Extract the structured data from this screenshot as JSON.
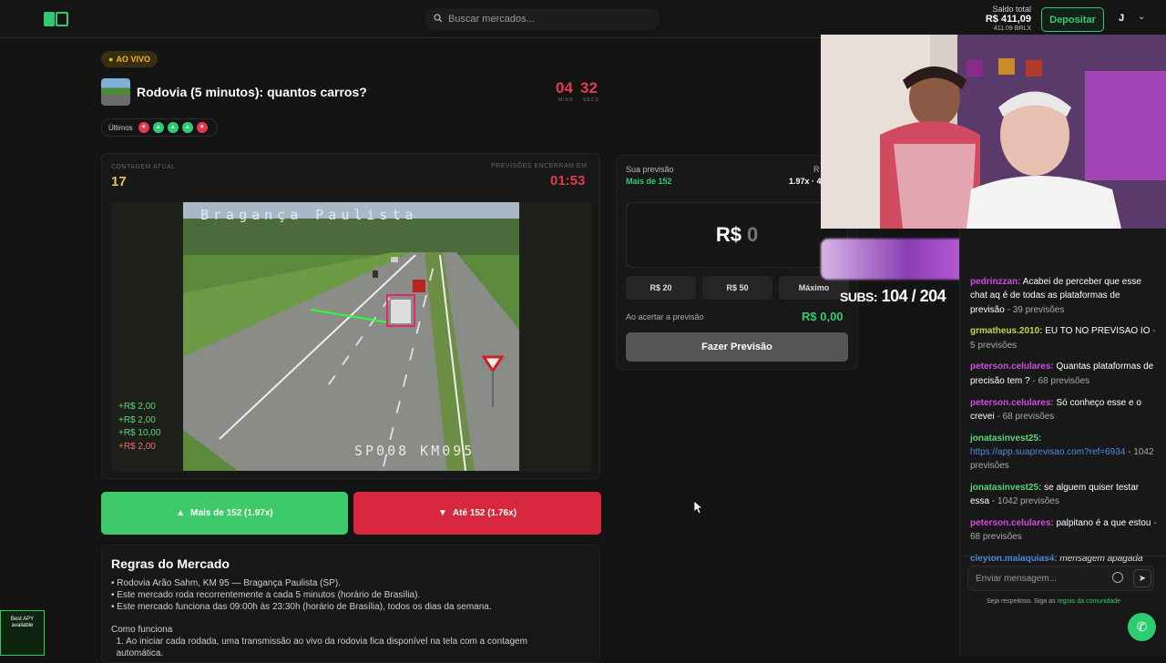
{
  "header": {
    "search_placeholder": "Buscar mercados...",
    "balance_label": "Saldo total",
    "balance_value": "R$ 411,09",
    "balance_sub": "411.09 BRLX",
    "deposit_label": "Depositar",
    "user_initial": "J"
  },
  "market": {
    "live_label": "AO VIVO",
    "title": "Rodovia (5 minutos): quantos carros?",
    "timer_min": "04",
    "timer_sec": "32",
    "timer_min_label": "MINS",
    "timer_sec_label": "SECS",
    "last_label": "Últimos",
    "last_results": [
      "down",
      "up",
      "up",
      "up",
      "down"
    ],
    "count_label": "CONTAGEM ATUAL",
    "count_value": "17",
    "ends_label": "PREVISÕES ENCERRAM EM",
    "ends_value": "01:53",
    "cam_title": "Bragança Paulista",
    "cam_code": "SP008 KM095",
    "recent_bets": [
      "+R$ 2,00",
      "+R$ 2,00",
      "+R$ 10,00",
      "+R$ 2,00"
    ],
    "btn_up_label": "Mais de 152 (1.97x)",
    "btn_down_label": "Até 152 (1.76x)"
  },
  "rules": {
    "title": "Regras do Mercado",
    "text": "• Rodovia Arão Sahm, KM 95 — Bragança Paulista (SP).\n• Este mercado roda recorrentemente a cada 5 minutos (horário de Brasília).\n• Este mercado funciona das 09:00h às 23:30h (horário de Brasília), todos os dias da semana.\n\nComo funciona\n  1. Ao iniciar cada rodada, uma transmissão ao vivo da rodovia fica disponível na tela com a contagem\n  automática."
  },
  "prediction": {
    "label": "Sua previsão",
    "choice": "Mais de 152",
    "right_label": "R",
    "multiplier": "1.97x · 4",
    "currency": "R$",
    "amount": "0",
    "chips": [
      "R$ 20",
      "R$ 50",
      "Máximo"
    ],
    "win_label": "Ao acertar a previsão",
    "win_value": "R$ 0,00",
    "submit_label": "Fazer Previsão"
  },
  "stream": {
    "subs_label": "SUBS:",
    "subs_value": "104 / 204"
  },
  "chat": {
    "messages": [
      {
        "user": "pedrinzzan:",
        "text": "Acabei de perceber que esse chat aq é de todas as plataformas de previsão",
        "count": " - 39 previsões",
        "style": "u1"
      },
      {
        "user": "grmatheus.2010:",
        "text": "EU TO NO PREVISAO IO",
        "count": " - 5 previsões",
        "style": "u2"
      },
      {
        "user": "peterson.celulares:",
        "text": "Quantas plataformas de precisão tem ?",
        "count": " - 68 previsões",
        "style": "u1"
      },
      {
        "user": "peterson.celulares:",
        "text": "Só conheço esse e o crevei",
        "count": " - 68 previsões",
        "style": "u1"
      },
      {
        "user": "jonatasinvest25:",
        "text": "https://app.suaprevisao.com?ref=6934",
        "count": " - 1042 previsões",
        "style": "u3",
        "link": true
      },
      {
        "user": "jonatasinvest25:",
        "text": "se alguem quiser testar essa",
        "count": " - 1042 previsões",
        "style": "u3"
      },
      {
        "user": "peterson.celulares:",
        "text": "palpitano é a que estou",
        "count": " - 68 previsões",
        "style": "u1"
      },
      {
        "user": "cleyton.malaquias4:",
        "text": "mensagem apagada",
        "count": "",
        "style": "u4",
        "deleted": true
      }
    ],
    "input_placeholder": "Enviar mensagem...",
    "footer_text": "Seja respeitoso. Siga as ",
    "footer_link": "regras da comunidade"
  },
  "overlay_badge": "Best APY available",
  "colors": {
    "accent": "#2ecc71",
    "danger": "#d8283f",
    "gold": "#f0b429"
  }
}
